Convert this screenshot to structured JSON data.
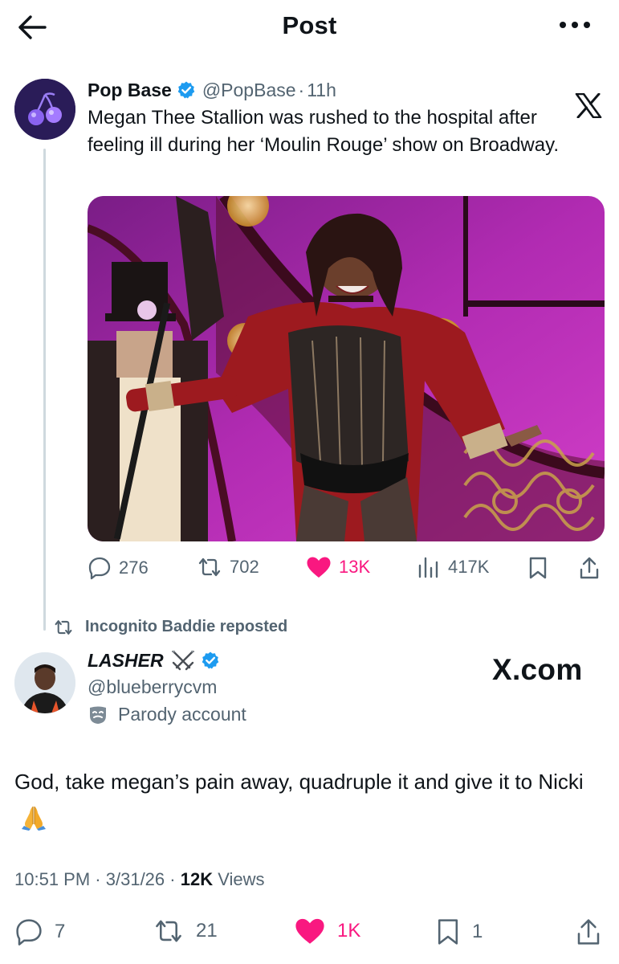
{
  "header": {
    "title": "Post"
  },
  "parent_tweet": {
    "author_name": "Pop Base",
    "handle": "@PopBase",
    "separator": "·",
    "time": "11h",
    "text": "Megan Thee Stallion was rushed to the hospital after feeling ill during her ‘Moulin Rouge’ show on Broadway.",
    "stats": {
      "replies": "276",
      "reposts": "702",
      "likes": "13K",
      "views": "417K"
    }
  },
  "repost_indicator": {
    "text": "Incognito Baddie reposted"
  },
  "main_tweet": {
    "author_name": "LASHER",
    "handle": "@blueberrycvm",
    "account_label": "Parody account",
    "text": "God, take megan’s pain away, quadruple it and give it to Nicki",
    "time": "10:51 PM",
    "date": "3/31/26",
    "separator": "·",
    "views_count": "12K",
    "views_label": "Views",
    "stats": {
      "replies": "7",
      "reposts": "21",
      "likes": "1K",
      "bookmarks": "1"
    }
  },
  "watermark": {
    "text": "X.com"
  },
  "colors": {
    "like": "#f91880",
    "verified": "#1d9bf0",
    "muted": "#536471",
    "text": "#0f1419"
  },
  "icons": [
    "back-arrow-icon",
    "more-icon",
    "verified-badge-icon",
    "x-logo-icon",
    "reply-icon",
    "repost-icon",
    "heart-icon",
    "views-icon",
    "bookmark-icon",
    "share-icon",
    "crossed-swords-icon",
    "mask-icon",
    "pray-hands-icon"
  ]
}
